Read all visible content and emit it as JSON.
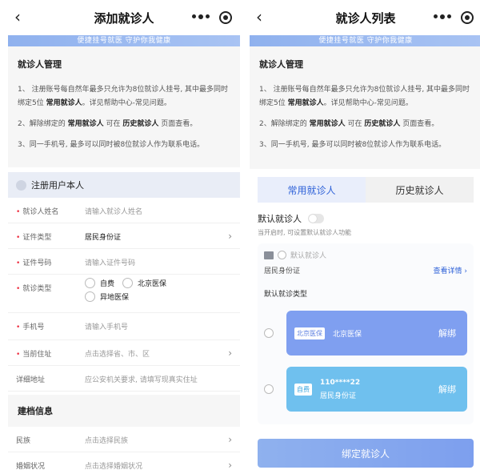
{
  "left": {
    "title": "添加就诊人",
    "banner": "便捷挂号就医 守护你我健康",
    "notice": {
      "heading": "就诊人管理",
      "p1a": "1、 注册账号每自然年最多只允许为8位就诊人挂号, 其中最多同时绑定5位 ",
      "p1b": "常用就诊人",
      "p1c": "。详见帮助中心-常见问题。",
      "p2a": "2、解除绑定的 ",
      "p2b": "常用就诊人",
      "p2c": " 可在 ",
      "p2d": "历史就诊人",
      "p2e": " 页面查看。",
      "p3": "3、同一手机号, 最多可以同时被8位就诊人作为联系电话。"
    },
    "self_label": "注册用户本人",
    "fields": {
      "name_label": "就诊人姓名",
      "name_placeholder": "请输入就诊人姓名",
      "idtype_label": "证件类型",
      "idtype_value": "居民身份证",
      "idno_label": "证件号码",
      "idno_placeholder": "请输入证件号码",
      "visittype_label": "就诊类型",
      "opt1": "自费",
      "opt2": "北京医保",
      "opt3": "异地医保",
      "phone_label": "手机号",
      "phone_placeholder": "请输入手机号",
      "addr_label": "当前住址",
      "addr_placeholder": "点击选择省、市、区",
      "detail_label": "详细地址",
      "detail_placeholder": "应公安机关要求, 请填写现真实住址"
    },
    "archive_title": "建档信息",
    "ethnic_label": "民族",
    "ethnic_placeholder": "点击选择民族",
    "marital_label": "婚姻状况",
    "marital_placeholder": "点击选择婚姻状况"
  },
  "right": {
    "title": "就诊人列表",
    "banner": "便捷挂号就医 守护你我健康",
    "notice": {
      "heading": "就诊人管理",
      "p1a": "1、 注册账号每自然年最多只允许为8位就诊人挂号, 其中最多同时绑定5位 ",
      "p1b": "常用就诊人",
      "p1c": "。详见帮助中心-常见问题。",
      "p2a": "2、解除绑定的 ",
      "p2b": "常用就诊人",
      "p2c": " 可在 ",
      "p2d": "历史就诊人",
      "p2e": " 页面查看。",
      "p3": "3、同一手机号, 最多可以同时被8位就诊人作为联系电话。"
    },
    "tab_common": "常用就诊人",
    "tab_history": "历史就诊人",
    "default_label": "默认就诊人",
    "default_hint": "当开启时, 可设置默认就诊人功能",
    "card": {
      "placeholder": "默认就诊人",
      "idtype": "居民身份证",
      "detail_link": "查看详情",
      "type_label": "默认就诊类型",
      "item1_tag": "北京医保",
      "item1_name": "北京医保",
      "item1_action": "解绑",
      "item2_tag": "自费",
      "item2_num": "110****22",
      "item2_sub": "居民身份证",
      "item2_action": "解绑"
    },
    "bind_button": "绑定就诊人"
  },
  "colors": {
    "accent": "#2f62d8",
    "banner": "#8fb1ee",
    "card_blue": "#7f9ff0",
    "card_cyan": "#6fc0ee",
    "required": "#e34444"
  }
}
